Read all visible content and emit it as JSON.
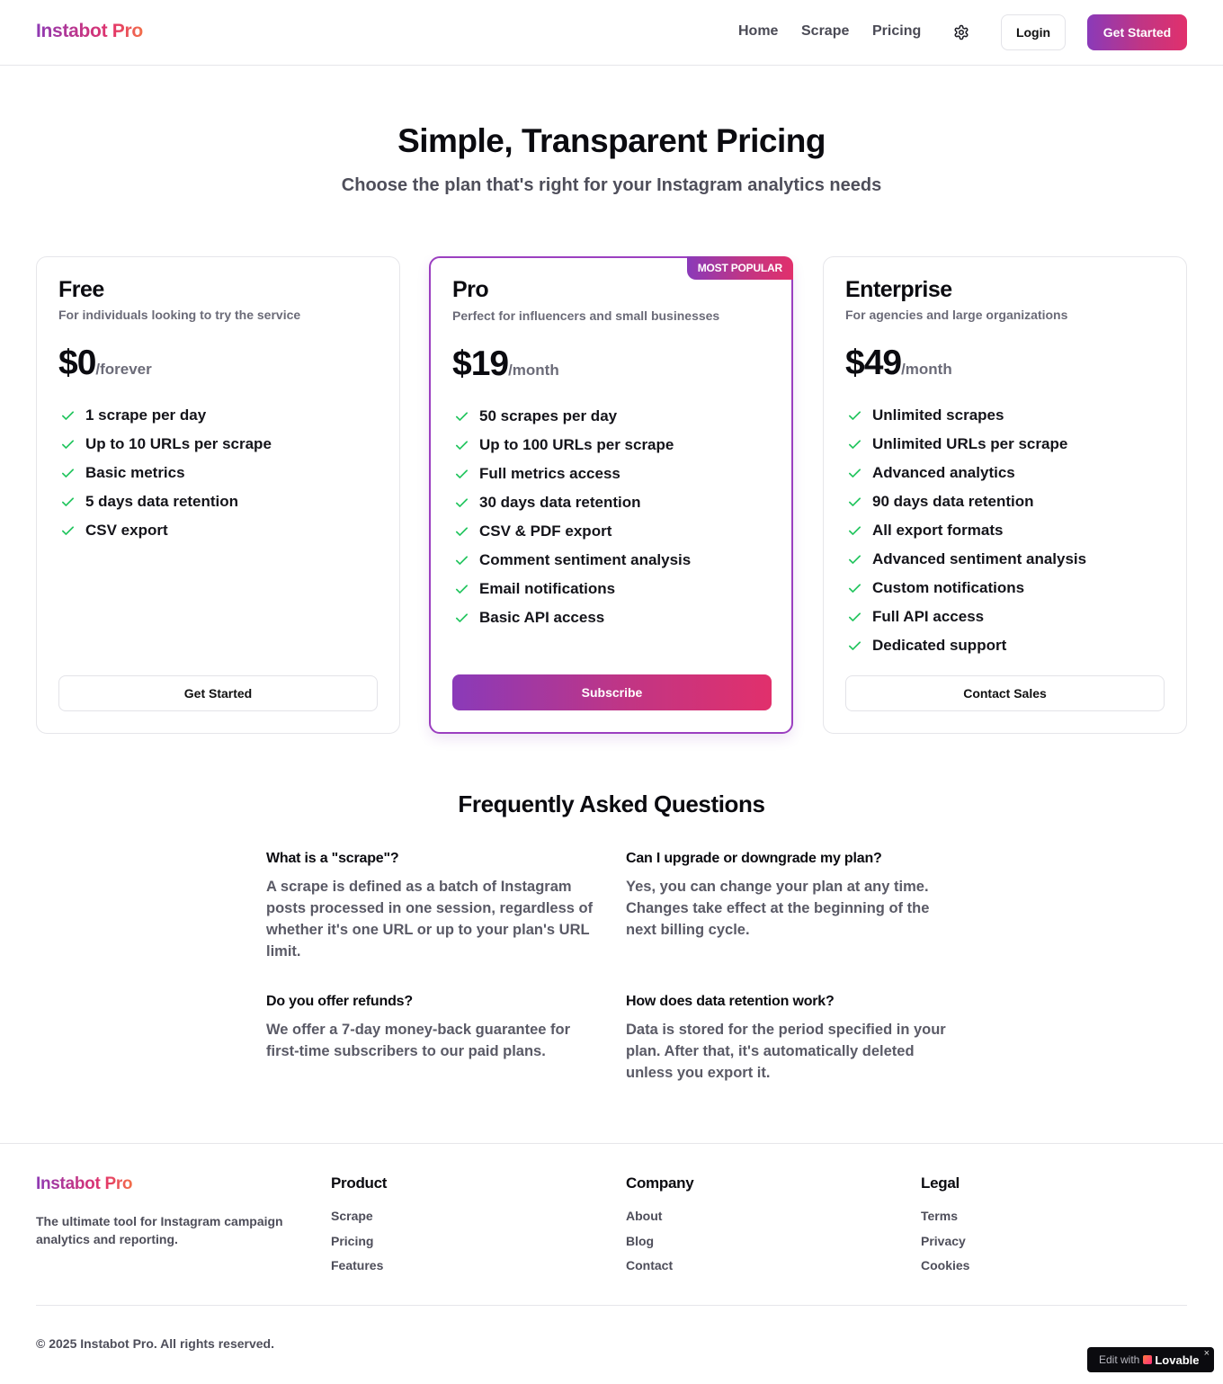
{
  "header": {
    "logo": "Instabot Pro",
    "nav": [
      "Home",
      "Scrape",
      "Pricing"
    ],
    "login": "Login",
    "get_started": "Get Started",
    "settings_icon": "gear-icon"
  },
  "hero": {
    "title": "Simple, Transparent Pricing",
    "subtitle": "Choose the plan that's right for your Instagram analytics needs"
  },
  "plans": [
    {
      "name": "Free",
      "description": "For individuals looking to try the service",
      "price": "$0",
      "period": "/forever",
      "features": [
        "1 scrape per day",
        "Up to 10 URLs per scrape",
        "Basic metrics",
        "5 days data retention",
        "CSV export"
      ],
      "cta": "Get Started"
    },
    {
      "name": "Pro",
      "badge": "MOST POPULAR",
      "description": "Perfect for influencers and small businesses",
      "price": "$19",
      "period": "/month",
      "features": [
        "50 scrapes per day",
        "Up to 100 URLs per scrape",
        "Full metrics access",
        "30 days data retention",
        "CSV & PDF export",
        "Comment sentiment analysis",
        "Email notifications",
        "Basic API access"
      ],
      "cta": "Subscribe"
    },
    {
      "name": "Enterprise",
      "description": "For agencies and large organizations",
      "price": "$49",
      "period": "/month",
      "features": [
        "Unlimited scrapes",
        "Unlimited URLs per scrape",
        "Advanced analytics",
        "90 days data retention",
        "All export formats",
        "Advanced sentiment analysis",
        "Custom notifications",
        "Full API access",
        "Dedicated support"
      ],
      "cta": "Contact Sales"
    }
  ],
  "faq": {
    "title": "Frequently Asked Questions",
    "items": [
      {
        "q": "What is a \"scrape\"?",
        "a": "A scrape is defined as a batch of Instagram posts processed in one session, regardless of whether it's one URL or up to your plan's URL limit."
      },
      {
        "q": "Can I upgrade or downgrade my plan?",
        "a": "Yes, you can change your plan at any time. Changes take effect at the beginning of the next billing cycle."
      },
      {
        "q": "Do you offer refunds?",
        "a": "We offer a 7-day money-back guarantee for first-time subscribers to our paid plans."
      },
      {
        "q": "How does data retention work?",
        "a": "Data is stored for the period specified in your plan. After that, it's automatically deleted unless you export it."
      }
    ]
  },
  "footer": {
    "logo": "Instabot Pro",
    "tagline": "The ultimate tool for Instagram campaign analytics and reporting.",
    "columns": [
      {
        "title": "Product",
        "links": [
          "Scrape",
          "Pricing",
          "Features"
        ]
      },
      {
        "title": "Company",
        "links": [
          "About",
          "Blog",
          "Contact"
        ]
      },
      {
        "title": "Legal",
        "links": [
          "Terms",
          "Privacy",
          "Cookies"
        ]
      }
    ],
    "copyright": "© 2025 Instabot Pro. All rights reserved."
  },
  "lovable_badge": {
    "edit": "Edit with",
    "brand": "Lovable",
    "close": "×"
  },
  "colors": {
    "accent_start": "#8a3ab9",
    "accent_end": "#e1306c",
    "check": "#22c55e"
  }
}
